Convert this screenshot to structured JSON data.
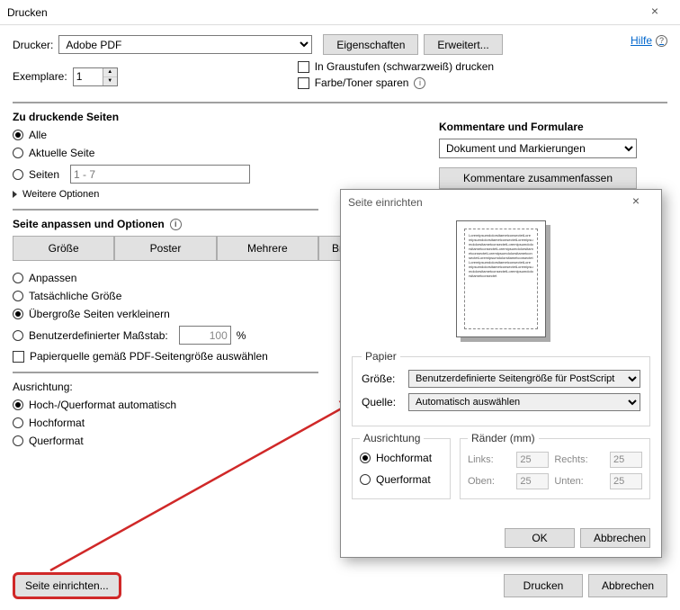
{
  "title": "Drucken",
  "help": "Hilfe",
  "printer": {
    "label": "Drucker:",
    "value": "Adobe PDF",
    "props_btn": "Eigenschaften",
    "adv_btn": "Erweitert..."
  },
  "copies": {
    "label": "Exemplare:",
    "value": "1"
  },
  "checks": {
    "grayscale": "In Graustufen (schwarzweiß) drucken",
    "savetoner": "Farbe/Toner sparen"
  },
  "pages": {
    "title": "Zu druckende Seiten",
    "all": "Alle",
    "current": "Aktuelle Seite",
    "range": "Seiten",
    "range_placeholder": "1 - 7",
    "more": "Weitere Optionen"
  },
  "fit": {
    "title": "Seite anpassen und Optionen",
    "btns": {
      "size": "Größe",
      "poster": "Poster",
      "multi": "Mehrere",
      "booklet": "Bro"
    },
    "fit_opt": "Anpassen",
    "actual": "Tatsächliche Größe",
    "shrink": "Übergroße Seiten verkleinern",
    "custom": "Benutzerdefinierter Maßstab:",
    "scale_value": "100",
    "scale_unit": "%",
    "src_by_pdf": "Papierquelle gemäß PDF-Seitengröße auswählen"
  },
  "orient": {
    "title": "Ausrichtung:",
    "auto": "Hoch-/Querformat automatisch",
    "portrait": "Hochformat",
    "landscape": "Querformat"
  },
  "comments": {
    "title": "Kommentare und Formulare",
    "value": "Dokument und Markierungen",
    "summarize": "Kommentare zusammenfassen"
  },
  "footer": {
    "page_setup": "Seite einrichten...",
    "print": "Drucken",
    "cancel": "Abbrechen"
  },
  "sub": {
    "title": "Seite einrichten",
    "paper": "Papier",
    "size_label": "Größe:",
    "size_value": "Benutzerdefinierte Seitengröße für PostScript",
    "source_label": "Quelle:",
    "source_value": "Automatisch auswählen",
    "orient_title": "Ausrichtung",
    "portrait": "Hochformat",
    "landscape": "Querformat",
    "margins_title": "Ränder (mm)",
    "left": "Links:",
    "right": "Rechts:",
    "top": "Oben:",
    "bottom": "Unten:",
    "m_left": "25",
    "m_right": "25",
    "m_top": "25",
    "m_bottom": "25",
    "ok": "OK",
    "cancel": "Abbrechen"
  }
}
